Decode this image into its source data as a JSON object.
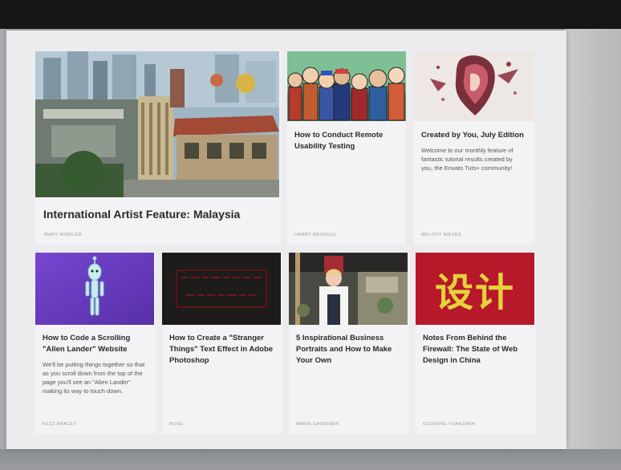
{
  "articles": {
    "feature": {
      "title": "International Artist Feature: Malaysia",
      "author": "Mary Winkler"
    },
    "remote": {
      "title": "How to Conduct Remote Usability Testing",
      "author": "Harry Brignull"
    },
    "created": {
      "title": "Created by You, July Edition",
      "description": "Welcome to our monthly feature of fantastic tutorial results created by you, the Envato Tuts+ community!",
      "author": "Melody Nieves"
    },
    "alien": {
      "title": "How to Code a Scrolling \"Alien Lander\" Website",
      "description": "We'll be putting things together so that as you scroll down from the top of the page you'll see an \"Alien Lander\" making its way to touch down.",
      "author": "Kezz Bracey"
    },
    "stranger": {
      "title": "How to Create a \"Stranger Things\" Text Effect in Adobe Photoshop",
      "author": "Rose"
    },
    "portraits": {
      "title": "5 Inspirational Business Portraits and How to Make Your Own",
      "author": "Marie Gardiner"
    },
    "china": {
      "title": "Notes From Behind the Firewall: The State of Web Design in China",
      "author": "Kezhong Yuanzhen",
      "thumb_text": "设计"
    }
  },
  "colors": {
    "accent_red": "#b7182a",
    "alien_purple": "#6a3bc3",
    "china_yellow": "#e4d23a"
  }
}
